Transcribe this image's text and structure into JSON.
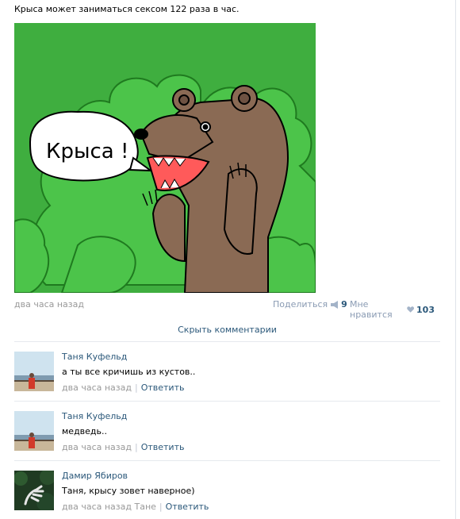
{
  "post": {
    "text": "Крыса может заниматься сексом 122 раза в час.",
    "image": {
      "icon": "bear-meme-image",
      "bubble_text": "Крыса !"
    },
    "time": "два часа назад",
    "share_label": "Поделиться",
    "share_count": "9",
    "like_label": "Мне нравится",
    "like_count": "103",
    "hide_comments_label": "Скрыть комментарии"
  },
  "comments": [
    {
      "author": "Таня Куфельд",
      "text": "а ты все кричишь из кустов..",
      "time": "два часа назад",
      "reply_label": "Ответить",
      "avatar": "beach-photo-avatar"
    },
    {
      "author": "Таня Куфельд",
      "text": "медведь..",
      "time": "два часа назад",
      "reply_label": "Ответить",
      "avatar": "beach-photo-avatar"
    },
    {
      "author": "Дамир Ябиров",
      "text": "Таня, крысу зовет наверное)",
      "time": "два часа назад",
      "to": "Тане",
      "reply_label": "Ответить",
      "avatar": "hand-forest-avatar"
    }
  ],
  "colors": {
    "link": "#2b587a",
    "muted": "#999999",
    "image_bg": "#3fae3f",
    "bush": "#4cc44a",
    "bear": "#8a6a54",
    "mouth": "#ff5a5a"
  }
}
